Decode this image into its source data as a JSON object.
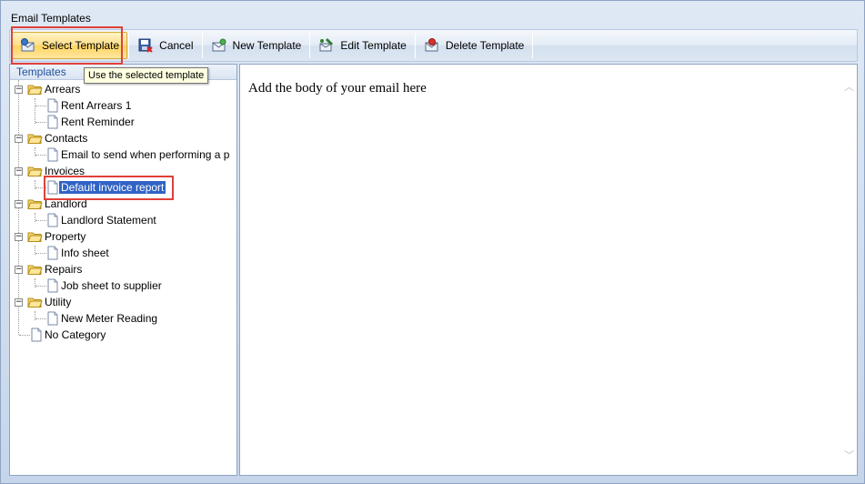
{
  "window": {
    "title": "Email Templates"
  },
  "toolbar": {
    "select": "Select Template",
    "cancel": "Cancel",
    "new": "New Template",
    "edit": "Edit Template",
    "delete": "Delete Template"
  },
  "tooltip": "Use the selected template",
  "tree": {
    "header": "Templates",
    "arrears": "Arrears",
    "rent_arrears_1": "Rent Arrears 1",
    "rent_reminder": "Rent Reminder",
    "contacts": "Contacts",
    "email_perform": "Email to send when performing a p",
    "invoices": "Invoices",
    "default_invoice": "Default invoice report",
    "landlord": "Landlord",
    "landlord_statement": "Landlord Statement",
    "property": "Property",
    "info_sheet": "Info sheet",
    "repairs": "Repairs",
    "job_sheet": "Job sheet to supplier",
    "utility": "Utility",
    "meter_reading": "New Meter Reading",
    "no_category": "No Category"
  },
  "editor": {
    "body": "Add the body of your email here"
  },
  "colors": {
    "selection": "#3163c5",
    "highlight_box": "#e0403a",
    "tooltip_bg": "#ffffe1"
  }
}
